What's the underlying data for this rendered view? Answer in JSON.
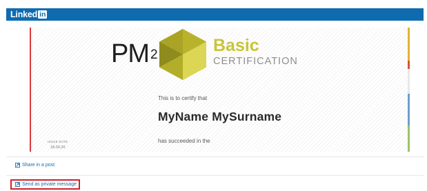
{
  "brand": {
    "logo_text": "Linked",
    "logo_badge": "in",
    "color": "#0f6bb0"
  },
  "certificate": {
    "program": "PM",
    "program_superscript": "2",
    "level": "Basic",
    "type": "CERTIFICATION",
    "certify_text": "This is to certify that",
    "recipient_name": "MyName MySurname",
    "succeeded_text": "has succeeded in the",
    "issue_date_label": "ISSUE DATE",
    "issue_date": "18.09.20",
    "colors": {
      "olive": "#c9c43a",
      "olive_dark": "#8f8b1e",
      "left_border": "#d8393f",
      "right_strip": [
        "#e4b235",
        "#d0563f",
        "#6b9fd1",
        "#9bc26b"
      ]
    }
  },
  "actions": [
    {
      "label": "Share in a post",
      "icon": "share-icon"
    },
    {
      "label": "Send as private message",
      "icon": "message-icon"
    }
  ],
  "highlight_color": "#d0212c"
}
